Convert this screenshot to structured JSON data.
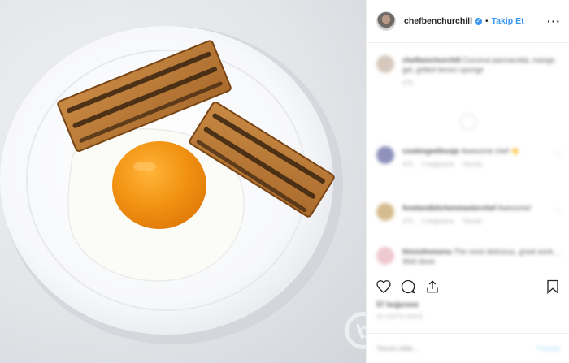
{
  "post": {
    "username": "chefbenchurchill",
    "separator": "•",
    "follow_label": "Takip Et",
    "more_icon": "more-horizontal-icon"
  },
  "caption": {
    "username": "chefbenchurchill",
    "text": "Coconut pannacotta, mango gel, grilled lemon sponge",
    "time": "47h"
  },
  "comments": [
    {
      "username": "cookingwithsaje",
      "text": "Awesome chef 👏",
      "meta": [
        "47h",
        "1 beğenme",
        "Yanıtla"
      ]
    },
    {
      "username": "foodandkitchenmasterchef",
      "text": "Awesome!",
      "meta": [
        "47h",
        "1 beğenme",
        "Yanıtla"
      ]
    },
    {
      "username": "thisisthemenu",
      "text": "The most delicious, great work. Well done",
      "meta": []
    }
  ],
  "engagement": {
    "likes": "57 beğenme",
    "date": "40 HAFTA ÖNCE"
  },
  "composer": {
    "placeholder": "Yorum ekle...",
    "post_label": "Paylaş"
  },
  "watermark": "b",
  "colors": {
    "link": "#3897f0",
    "text": "#262626",
    "muted": "#999999",
    "yolk": "#f39c1c",
    "plate": "#fbfbfb"
  }
}
